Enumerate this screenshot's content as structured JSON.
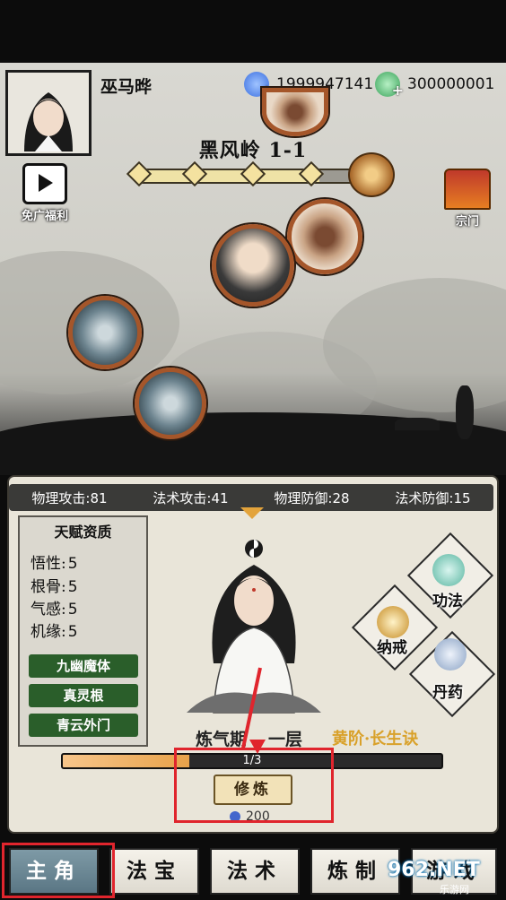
{
  "player": {
    "name": "巫马晔"
  },
  "currencies": [
    {
      "icon": "blue-spirit-flame-icon",
      "value": "1999947141",
      "color": "#3b6fe0"
    },
    {
      "icon": "green-spirit-stone-icon",
      "value": "300000001",
      "color": "#3aa35a"
    }
  ],
  "stage": {
    "title": "黑风岭 1-1"
  },
  "side_buttons": {
    "free_reward": "免广福利",
    "sect": "宗门"
  },
  "stats": [
    {
      "label": "物理攻击:",
      "value": "81"
    },
    {
      "label": "法术攻击:",
      "value": "41"
    },
    {
      "label": "物理防御:",
      "value": "28"
    },
    {
      "label": "法术防御:",
      "value": "15"
    }
  ],
  "talent": {
    "title": "天赋资质",
    "attrs": [
      {
        "label": "悟性:",
        "value": "5"
      },
      {
        "label": "根骨:",
        "value": "5"
      },
      {
        "label": "气感:",
        "value": "5"
      },
      {
        "label": "机缘:",
        "value": "5"
      }
    ],
    "traits": [
      "九幽魔体",
      "真灵根",
      "青云外门"
    ]
  },
  "skills": {
    "gongfa": "功法",
    "ring": "纳戒",
    "pill": "丹药"
  },
  "cultivation": {
    "realm_prefix": "炼气期",
    "realm_suffix": "一层",
    "method": "黄阶·长生诀",
    "progress_text": "1/3",
    "progress_fraction": 0.333,
    "button": "修炼",
    "cost": "200"
  },
  "nav": [
    "主角",
    "法宝",
    "法术",
    "炼制",
    "游戏"
  ],
  "watermark": {
    "brand": "962.NET",
    "sub": "乐游网"
  },
  "colors": {
    "highlight": "#e0252d",
    "gold": "#d9a12a",
    "trait_green": "#2a5e2a"
  }
}
